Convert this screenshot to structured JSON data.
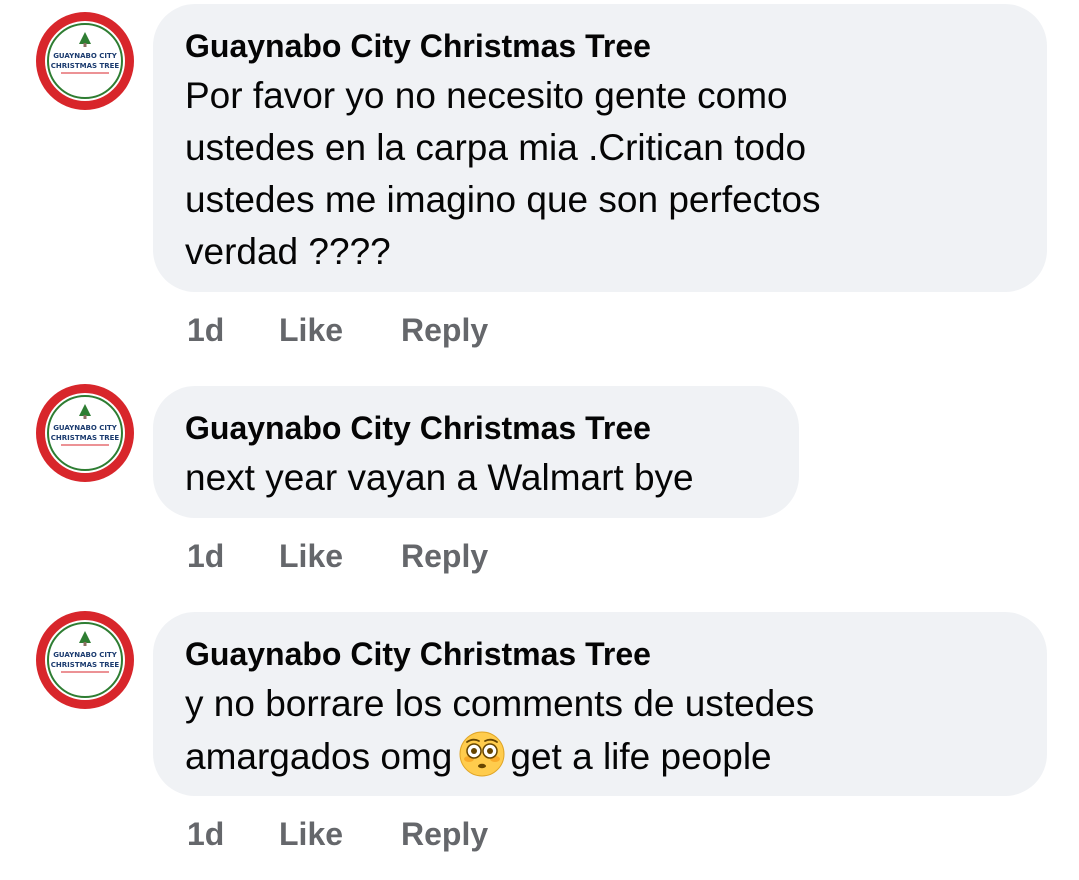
{
  "comments": [
    {
      "author": "Guaynabo City Christmas Tree",
      "avatar_text": [
        "GUAYNABO CITY",
        "CHRISTMAS TREE"
      ],
      "lines": [
        "Por favor yo no necesito gente como",
        "ustedes en la carpa mia .Critican todo",
        "ustedes me imagino que son perfectos",
        "verdad ????"
      ],
      "time": "1d",
      "like_label": "Like",
      "reply_label": "Reply"
    },
    {
      "author": "Guaynabo City Christmas Tree",
      "avatar_text": [
        "GUAYNABO CITY",
        "CHRISTMAS TREE"
      ],
      "lines": [
        "next year vayan a Walmart bye"
      ],
      "time": "1d",
      "like_label": "Like",
      "reply_label": "Reply"
    },
    {
      "author": "Guaynabo City Christmas Tree",
      "avatar_text": [
        "GUAYNABO CITY",
        "CHRISTMAS TREE"
      ],
      "lines": [
        "y no borrare los comments de ustedes"
      ],
      "line2_before_emoji": "amargados omg",
      "emoji": "flushed-face-emoji",
      "line2_after_emoji": "get a life people",
      "time": "1d",
      "like_label": "Like",
      "reply_label": "Reply"
    }
  ],
  "colors": {
    "bubble": "#f0f2f5",
    "secondary_text": "#65676b",
    "avatar_red": "#d8262b",
    "avatar_green": "#2e7d32"
  }
}
